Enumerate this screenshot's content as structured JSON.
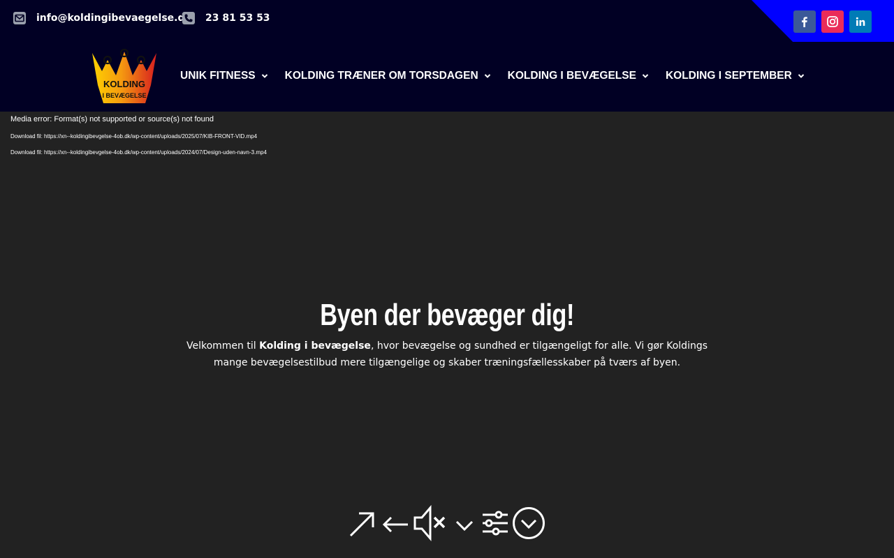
{
  "topbar": {
    "email": "info@koldingibevaegelse.dk",
    "phone": "23 81 53 53",
    "social": [
      "facebook-icon",
      "instagram-icon",
      "linkedin-icon"
    ],
    "accent": "#0000ff"
  },
  "logo": {
    "line1": "KOLDING",
    "line2": "I BEVÆGELSE"
  },
  "nav": {
    "items": [
      {
        "label": "UNIK FITNESS"
      },
      {
        "label": "KOLDING TRÆNER OM TORSDAGEN"
      },
      {
        "label": "KOLDING I BEVÆGELSE"
      },
      {
        "label": "KOLDING I SEPTEMBER"
      }
    ]
  },
  "media": {
    "error": "Media error: Format(s) not supported or source(s) not found",
    "download1": "Download fil: https://xn--koldingibevgelse-4ob.dk/wp-content/uploads/2025/07/KIB-FRONT-VID.mp4",
    "download2": "Download fil: https://xn--koldingibevgelse-4ob.dk/wp-content/uploads/2024/07/Design-uden-navn-3.mp4"
  },
  "hero": {
    "title": "Byen der bevæger dig!",
    "text_before": "Velkommen til ",
    "text_bold": "Kolding i bevægelse",
    "text_after": ", hvor bevægelse og sundhed er tilgængeligt for alle. Vi gør Koldings mange bevægelsestilbud mere tilgængelige og skaber træningsfællesskaber på tværs af byen."
  },
  "controls": [
    "arrow-up-right-icon",
    "arrow-left-icon",
    "mute-icon",
    "chevron-down-icon",
    "sliders-icon",
    "circle-chevron-down-icon"
  ],
  "colors": {
    "header_bg": "#010024",
    "page_bg": "#222222"
  }
}
